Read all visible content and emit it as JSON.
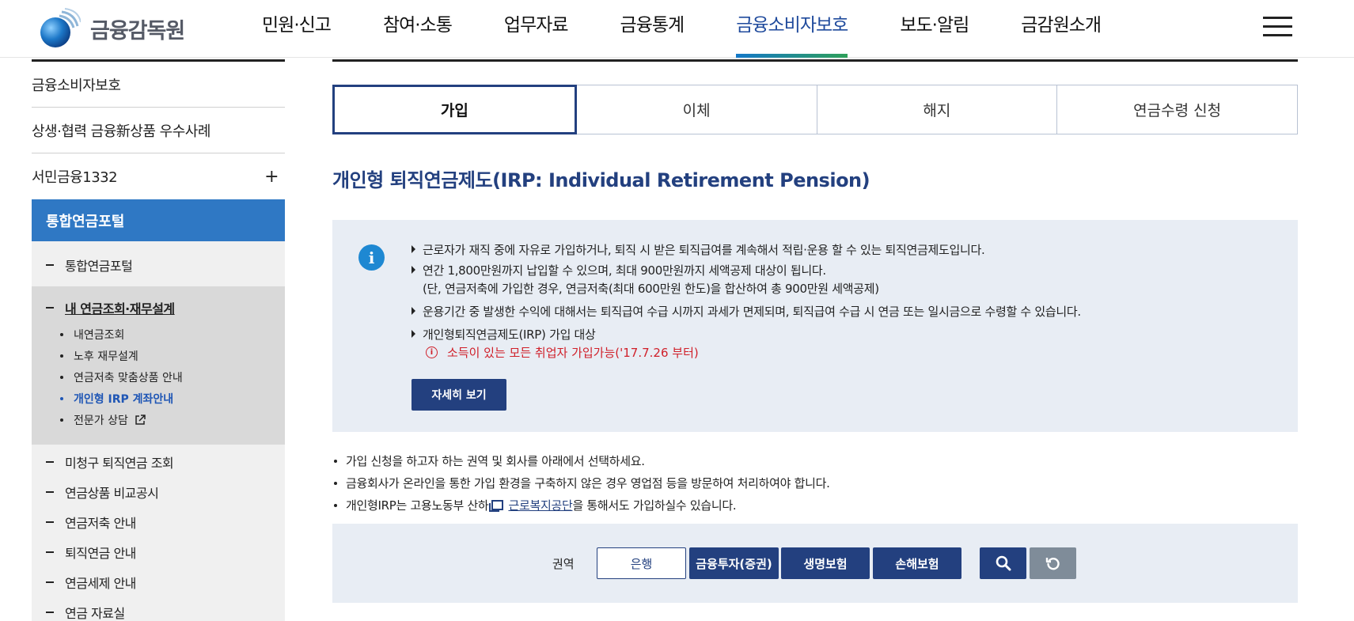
{
  "header": {
    "logo_text": "금융감독원",
    "nav": [
      {
        "label": "민원·신고"
      },
      {
        "label": "참여·소통"
      },
      {
        "label": "업무자료"
      },
      {
        "label": "금융통계"
      },
      {
        "label": "금융소비자보호"
      },
      {
        "label": "보도·알림"
      },
      {
        "label": "금감원소개"
      }
    ],
    "active_nav": "금융소비자보호"
  },
  "sidebar": {
    "items": [
      {
        "label": "금융소비자보호"
      },
      {
        "label": "상생·협력 금융新상품 우수사례"
      },
      {
        "label": "서민금융1332",
        "expand": "+"
      }
    ],
    "section": "통합연금포털",
    "sub_items": [
      {
        "label": "통합연금포털"
      },
      {
        "label": "내 연금조회·재무설계"
      },
      {
        "label": "미청구 퇴직연금 조회"
      },
      {
        "label": "연금상품 비교공시"
      },
      {
        "label": "연금저축 안내"
      },
      {
        "label": "퇴직연금 안내"
      },
      {
        "label": "연금세제 안내"
      },
      {
        "label": "연금 자료실"
      }
    ],
    "third_items": [
      {
        "label": "내연금조회"
      },
      {
        "label": "노후 재무설계"
      },
      {
        "label": "연금저축 맞춤상품 안내"
      },
      {
        "label": "개인형 IRP 계좌안내"
      },
      {
        "label": "전문가 상담"
      }
    ]
  },
  "main": {
    "tabs": [
      {
        "label": "가입"
      },
      {
        "label": "이체"
      },
      {
        "label": "해지"
      },
      {
        "label": "연금수령 신청"
      }
    ],
    "title": "개인형 퇴직연금제도(IRP: Individual Retirement Pension)",
    "info": {
      "line1": "근로자가 재직 중에 자유로 가입하거나, 퇴직 시 받은 퇴직급여를 계속해서 적립·운용 할 수 있는 퇴직연금제도입니다.",
      "line2": "연간 1,800만원까지 납입할 수 있으며, 최대 900만원까지 세액공제 대상이 됩니다.",
      "line2_sub": "(단, 연금저축에 가입한 경우, 연금저축(최대 600만원 한도)을 합산하여 총 900만원 세액공제)",
      "line3": "운용기간 중 발생한 수익에 대해서는 퇴직급여 수급 시까지 과세가 면제되며, 퇴직급여 수급 시 연금 또는 일시금으로 수령할 수 있습니다.",
      "line4": "개인형퇴직연금제도(IRP) 가입 대상",
      "line4_red": "소득이 있는 모든 취업자 가입가능('17.7.26 부터)",
      "detail_button": "자세히 보기"
    },
    "notes": {
      "n1": "가입 신청을 하고자 하는 권역 및 회사를 아래에서 선택하세요.",
      "n2": "금융회사가 온라인을 통한 가입 환경을 구축하지 않은 경우 영업점 등을 방문하여 처리하여야 합니다.",
      "n3_pre": "개인형IRP는 고용노동부 산하",
      "n3_link": "근로복지공단",
      "n3_post": "을 통해서도 가입하실수 있습니다."
    },
    "search": {
      "region_label": "권역",
      "options": [
        {
          "label": "은행"
        },
        {
          "label": "금융투자(증권)"
        },
        {
          "label": "생명보험"
        },
        {
          "label": "손해보험"
        }
      ],
      "selected": "은행"
    }
  },
  "colors": {
    "navy": "#23407f",
    "sidebar_blue": "#2f78c4",
    "info_bg": "#e8edf4",
    "warning_red": "#d0202a",
    "reset_gray": "#7f8c99"
  }
}
